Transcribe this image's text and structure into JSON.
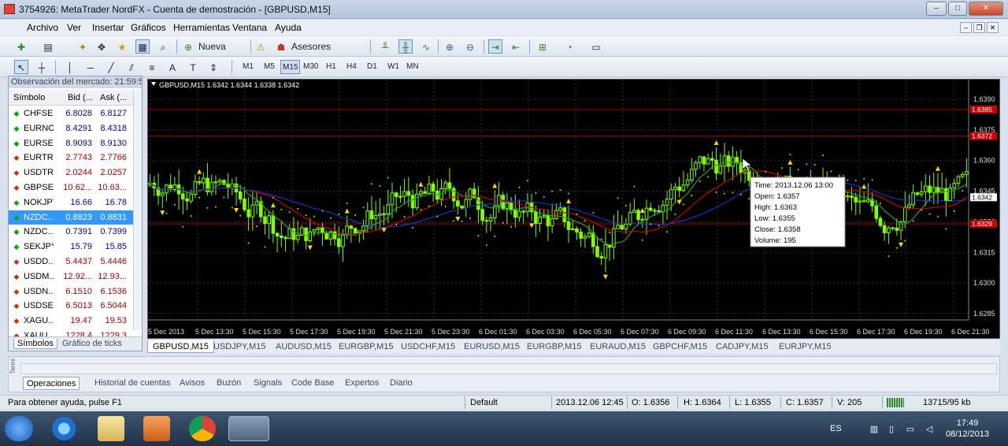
{
  "window": {
    "title": "3754926: MetaTrader NordFX - Cuenta de demostración - [GBPUSD,M15]",
    "controls": [
      "–",
      "□",
      "✕"
    ]
  },
  "menu": [
    "Archivo",
    "Ver",
    "Insertar",
    "Gráficos",
    "Herramientas",
    "Ventana",
    "Ayuda"
  ],
  "toolbar": {
    "new_order": "Nueva orden",
    "experts": "Asesores expertos"
  },
  "timeframes": [
    "M1",
    "M5",
    "M15",
    "M30",
    "H1",
    "H4",
    "D1",
    "W1",
    "MN"
  ],
  "timeframe_selected": "M15",
  "market_watch": {
    "header": "Observación del mercado: 21:59:5",
    "col_symbol": "Símbolo",
    "col_bid": "Bid (...",
    "col_ask": "Ask (...",
    "rows": [
      {
        "symbol": "CHFSEK",
        "bid": "6.8028",
        "ask": "6.8127",
        "dir": "up"
      },
      {
        "symbol": "EURNOK",
        "bid": "8.4291",
        "ask": "8.4318",
        "dir": "up"
      },
      {
        "symbol": "EURSEK",
        "bid": "8.9093",
        "ask": "8.9130",
        "dir": "up"
      },
      {
        "symbol": "EURTRY",
        "bid": "2.7743",
        "ask": "2.7766",
        "dir": "down"
      },
      {
        "symbol": "USDTRY",
        "bid": "2.0244",
        "ask": "2.0257",
        "dir": "down"
      },
      {
        "symbol": "GBPSEK",
        "bid": "10.62...",
        "ask": "10.63...",
        "dir": "down"
      },
      {
        "symbol": "NOKJPY",
        "bid": "16.66",
        "ask": "16.78",
        "dir": "up"
      },
      {
        "symbol": "NZDC...",
        "bid": "0.8823",
        "ask": "0.8831",
        "dir": "up",
        "selected": true
      },
      {
        "symbol": "NZDC...",
        "bid": "0.7391",
        "ask": "0.7399",
        "dir": "up"
      },
      {
        "symbol": "SEKJPY",
        "bid": "15.79",
        "ask": "15.85",
        "dir": "up"
      },
      {
        "symbol": "USDD...",
        "bid": "5.4437",
        "ask": "5.4446",
        "dir": "down"
      },
      {
        "symbol": "USDM...",
        "bid": "12.92...",
        "ask": "12.93...",
        "dir": "down"
      },
      {
        "symbol": "USDN...",
        "bid": "6.1510",
        "ask": "6.1536",
        "dir": "down"
      },
      {
        "symbol": "USDSEK",
        "bid": "6.5013",
        "ask": "6.5044",
        "dir": "down"
      },
      {
        "symbol": "XAGU...",
        "bid": "19.47",
        "ask": "19.53",
        "dir": "down"
      },
      {
        "symbol": "XAUU...",
        "bid": "1228.4",
        "ask": "1229.3",
        "dir": "down"
      }
    ],
    "tabs": [
      "Símbolos",
      "Gráfico de ticks"
    ]
  },
  "chart": {
    "header": "GBPUSD,M15  1.6342 1.6344 1.6338 1.6342",
    "price_ticks": [
      "1.6390",
      "1.6375",
      "1.6360",
      "1.6345",
      "1.6330",
      "1.6315",
      "1.6300",
      "1.6285"
    ],
    "price_tags": [
      {
        "text": "1.6385",
        "color": "#cc0000"
      },
      {
        "text": "1.6372",
        "color": "#cc0000"
      },
      {
        "text": "1.6342",
        "color": "#ffffff"
      },
      {
        "text": "1.6329",
        "color": "#cc0000"
      }
    ],
    "time_ticks": [
      "5 Dec 2013",
      "5 Dec 13:30",
      "5 Dec 15:30",
      "5 Dec 17:30",
      "5 Dec 19:30",
      "5 Dec 21:30",
      "5 Dec 23:30",
      "6 Dec 01:30",
      "6 Dec 03:30",
      "6 Dec 05:30",
      "6 Dec 07:30",
      "6 Dec 09:30",
      "6 Dec 11:30",
      "6 Dec 13:30",
      "6 Dec 15:30",
      "6 Dec 17:30",
      "6 Dec 19:30",
      "6 Dec 21:30"
    ],
    "tooltip": [
      "Time: 2013.12.06 13:00",
      "Open: 1.6357",
      "High: 1.6363",
      "Low:  1.6355",
      "Close: 1.6358",
      "Volume: 195"
    ],
    "colors": {
      "bg": "#000000",
      "candle": "#7fff00",
      "grid": "#333333",
      "ma_red": "#cc0000",
      "ma_blue": "#2030c0",
      "ma_green": "#2aa02a",
      "fractal": "#ffd700"
    }
  },
  "chart_tabs": [
    "GBPUSD,M15",
    "USDJPY,M15",
    "AUDUSD,M15",
    "EURGBP,M15",
    "USDCHF,M15",
    "EURUSD,M15",
    "EURGBP,M15",
    "EURAUD,M15",
    "GBPCHF,M15",
    "CADJPY,M15",
    "EURJPY,M15"
  ],
  "terminal": {
    "side_label": "Termi",
    "tabs": [
      "Operaciones",
      "Historial de cuentas",
      "Avisos",
      "Buzón",
      "Signals",
      "Code Base",
      "Expertos",
      "Diario"
    ]
  },
  "status": {
    "help": "Para obtener ayuda, pulse F1",
    "profile": "Default",
    "datetime": "2013.12.06 12:45",
    "open": "O: 1.6356",
    "high": "H: 1.6364",
    "low": "L: 1.6355",
    "close": "C: 1.6357",
    "volume": "V: 205",
    "traffic": "13715/95 kb"
  },
  "taskbar": {
    "lang": "ES",
    "time": "17:49",
    "date": "08/12/2013"
  }
}
